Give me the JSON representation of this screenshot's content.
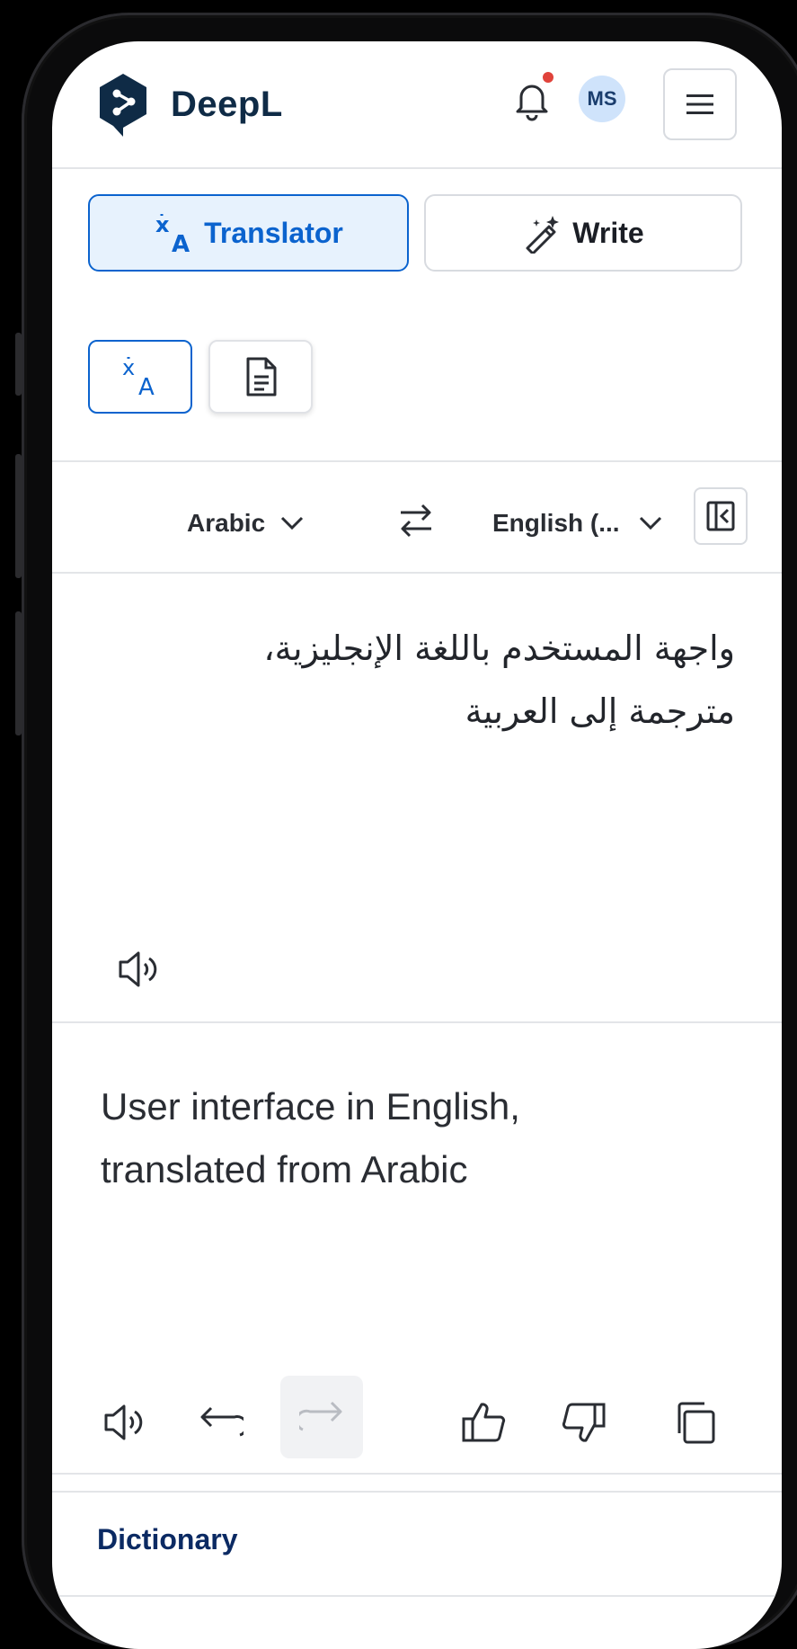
{
  "header": {
    "brand": "DeepL",
    "avatar_initials": "MS",
    "notification_badge_color": "#e0433b"
  },
  "modes": {
    "translator_label": "Translator",
    "write_label": "Write"
  },
  "languages": {
    "source": "Arabic",
    "target": "English (..."
  },
  "source_text_lines": [
    "واجهة المستخدم باللغة الإنجليزية،",
    "مترجمة إلى العربية"
  ],
  "target_text_lines": [
    "User interface in English,",
    "translated from Arabic"
  ],
  "footer": {
    "dictionary_label": "Dictionary"
  },
  "colors": {
    "accent": "#0b63ce",
    "brand_dark": "#0f2b46"
  }
}
